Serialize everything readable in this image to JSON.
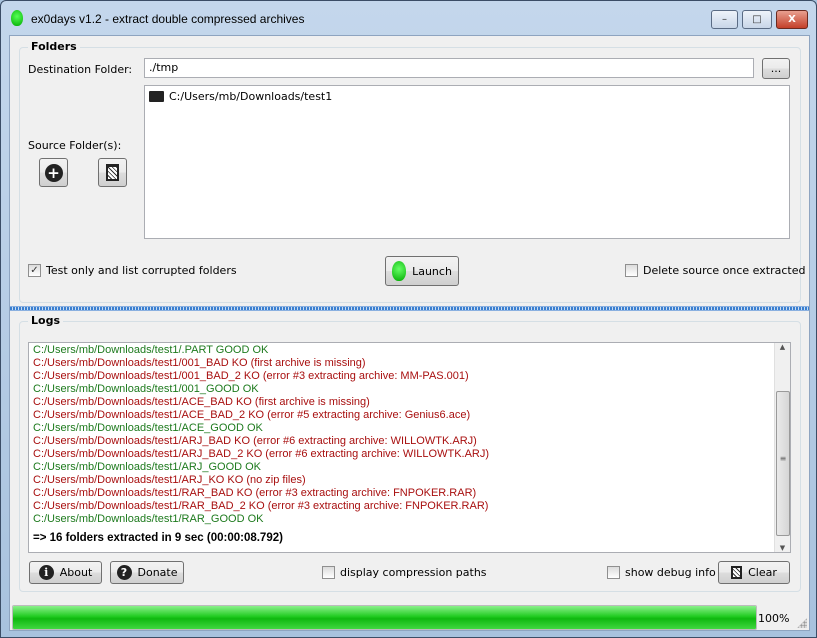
{
  "window": {
    "title": "ex0days v1.2 - extract double compressed archives",
    "minimize": "▭",
    "maximize": "▣",
    "close": "X"
  },
  "folders": {
    "title": "Folders",
    "destination_label": "Destination Folder:",
    "destination_value": "./tmp",
    "browse_label": "...",
    "source_label": "Source Folder(s):",
    "sources": [
      "C:/Users/mb/Downloads/test1"
    ],
    "test_only_label": "Test only and list corrupted folders",
    "test_only_checked": true,
    "launch_label": "Launch",
    "delete_source_label": "Delete source once extracted",
    "delete_source_checked": false
  },
  "logs": {
    "title": "Logs",
    "lines": [
      {
        "text": "C:/Users/mb/Downloads/test1/.PART GOOD OK",
        "status": "ok"
      },
      {
        "text": "C:/Users/mb/Downloads/test1/001_BAD KO (first archive is missing)",
        "status": "ko"
      },
      {
        "text": "C:/Users/mb/Downloads/test1/001_BAD_2 KO (error #3 extracting archive: MM-PAS.001)",
        "status": "ko"
      },
      {
        "text": "C:/Users/mb/Downloads/test1/001_GOOD OK",
        "status": "ok"
      },
      {
        "text": "C:/Users/mb/Downloads/test1/ACE_BAD KO (first archive is missing)",
        "status": "ko"
      },
      {
        "text": "C:/Users/mb/Downloads/test1/ACE_BAD_2 KO (error #5 extracting archive: Genius6.ace)",
        "status": "ko"
      },
      {
        "text": "C:/Users/mb/Downloads/test1/ACE_GOOD OK",
        "status": "ok"
      },
      {
        "text": "C:/Users/mb/Downloads/test1/ARJ_BAD KO (error #6 extracting archive: WILLOWTK.ARJ)",
        "status": "ko"
      },
      {
        "text": "C:/Users/mb/Downloads/test1/ARJ_BAD_2 KO (error #6 extracting archive: WILLOWTK.ARJ)",
        "status": "ko"
      },
      {
        "text": "C:/Users/mb/Downloads/test1/ARJ_GOOD OK",
        "status": "ok"
      },
      {
        "text": "C:/Users/mb/Downloads/test1/ARJ_KO KO (no zip files)",
        "status": "ko"
      },
      {
        "text": "C:/Users/mb/Downloads/test1/RAR_BAD KO (error #3 extracting archive: FNPOKER.RAR)",
        "status": "ko"
      },
      {
        "text": "C:/Users/mb/Downloads/test1/RAR_BAD_2 KO (error #3 extracting archive: FNPOKER.RAR)",
        "status": "ko"
      },
      {
        "text": "C:/Users/mb/Downloads/test1/RAR_GOOD OK",
        "status": "ok"
      }
    ],
    "summary": "=> 16 folders extracted in 9 sec (00:00:08.792)",
    "colors": {
      "ok": "#1d7a1d",
      "ko": "#a80f0f"
    }
  },
  "footer": {
    "about_label": "About",
    "donate_label": "Donate",
    "compression_paths_label": "display compression paths",
    "compression_paths_checked": false,
    "debug_label": "show debug info",
    "debug_checked": false,
    "clear_label": "Clear"
  },
  "progress": {
    "value": 100,
    "label": "100%"
  }
}
